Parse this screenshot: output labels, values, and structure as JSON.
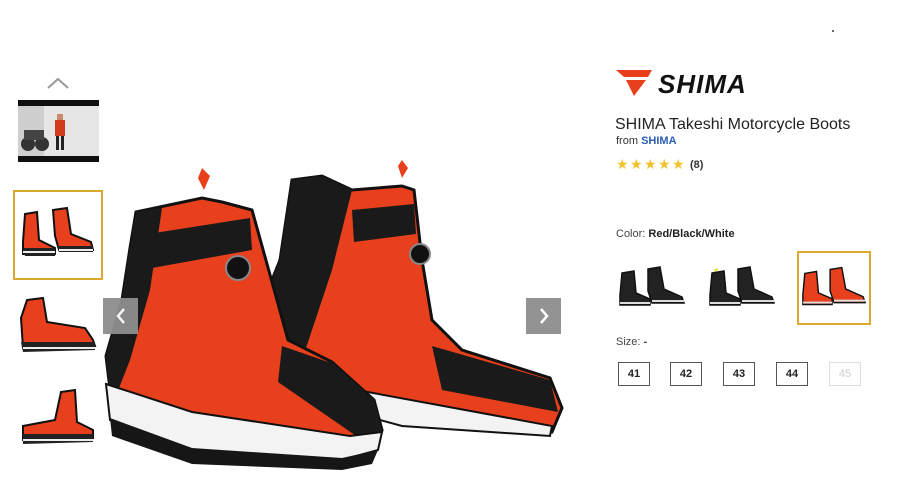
{
  "product": {
    "brand": "SHIMA",
    "title": "SHIMA Takeshi Motorcycle Boots",
    "from_prefix": "from",
    "from_brand": "SHIMA",
    "rating": 5,
    "review_count": "(8)"
  },
  "gallery": {
    "up_icon": "chevron-up-icon",
    "prev_icon": "chevron-left-icon",
    "next_icon": "chevron-right-icon",
    "thumbnails": [
      "video",
      "pair-front",
      "side",
      "side-rear"
    ],
    "selected_index": 1
  },
  "color": {
    "label": "Color:",
    "selected": "Red/Black/White",
    "swatches": [
      "Black",
      "Black/Yellow",
      "Red/Black/White"
    ],
    "selected_index": 2
  },
  "size": {
    "label": "Size:",
    "selected": "-",
    "options": [
      {
        "label": "41",
        "available": true
      },
      {
        "label": "42",
        "available": true
      },
      {
        "label": "43",
        "available": true
      },
      {
        "label": "44",
        "available": true
      },
      {
        "label": "45",
        "available": false
      }
    ]
  },
  "colors": {
    "accent_red": "#e8401c",
    "selected_border": "#d9a82d",
    "star": "#f2c12e",
    "link": "#2a5db0"
  }
}
